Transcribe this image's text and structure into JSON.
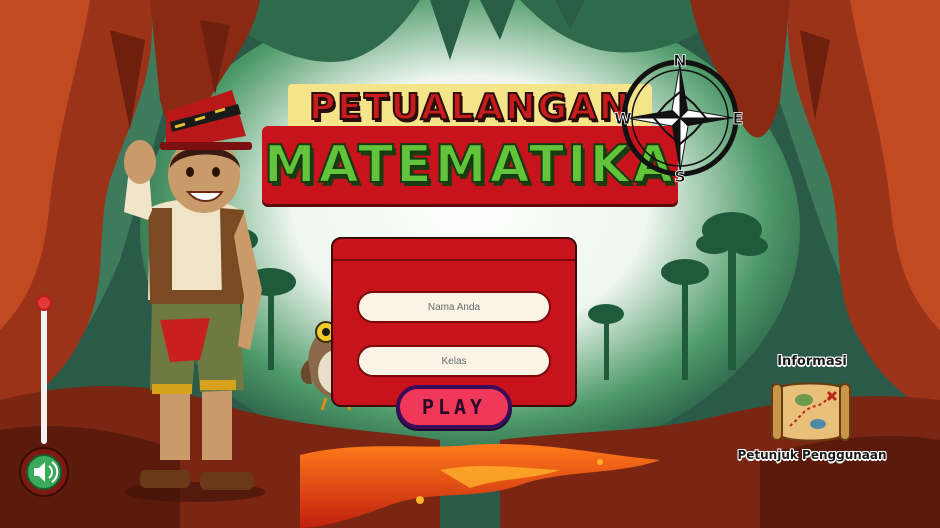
{
  "title": {
    "line1": "PETUALANGAN",
    "line2": "MATEMATIKA"
  },
  "compass": {
    "north": "N",
    "east": "E",
    "south": "S",
    "west": "W"
  },
  "login_form": {
    "name_placeholder": "Nama Anda",
    "class_placeholder": "Kelas",
    "play_label": "PLAY"
  },
  "info": {
    "title": "Informasi",
    "guide_label": "Petunjuk Penggunaan"
  },
  "volume": {
    "level": 0.95
  },
  "icons": {
    "sound": "speaker-icon",
    "map": "treasure-map-icon",
    "compass": "compass-rose-icon"
  },
  "colors": {
    "panel_red": "#c8121c",
    "title_green": "#62c43a",
    "title_yellow": "#f4e48a",
    "play_pink": "#f2385a",
    "lava": "#e0341a",
    "cave": "#8a2a14"
  }
}
